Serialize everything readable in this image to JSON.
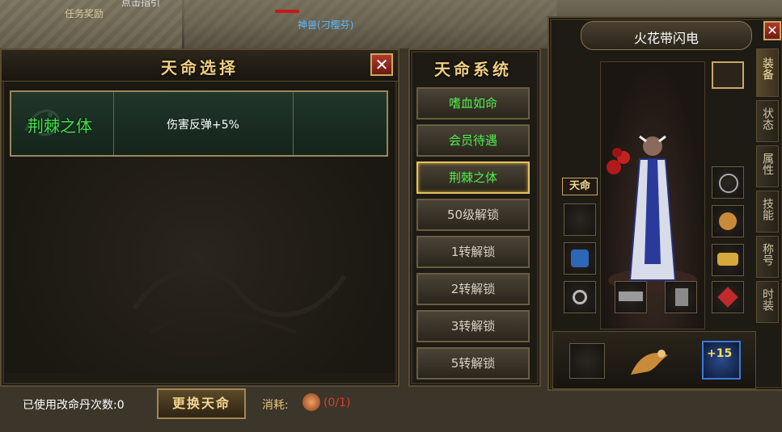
{
  "world": {
    "task_reward_label": "任务奖励",
    "top_left_partial": "点击指引",
    "npc_name": "神兽(刁樱芬)"
  },
  "fate_select": {
    "title": "天命选择",
    "selected_row": {
      "name": "荆棘之体",
      "desc": "伤害反弹+5%"
    },
    "used_count_label": "已使用改命丹次数:0",
    "change_button": "更换天命",
    "cost_label": "消耗:",
    "cost_value": "(0/1)"
  },
  "fate_system": {
    "title": "天命系统",
    "items": [
      {
        "label": "嗜血如命",
        "state": "unlocked"
      },
      {
        "label": "会员待遇",
        "state": "unlocked"
      },
      {
        "label": "荆棘之体",
        "state": "selected"
      },
      {
        "label": "50级解锁",
        "state": "locked"
      },
      {
        "label": "1转解锁",
        "state": "locked"
      },
      {
        "label": "2转解锁",
        "state": "locked"
      },
      {
        "label": "3转解锁",
        "state": "locked"
      },
      {
        "label": "5转解锁",
        "state": "locked"
      }
    ]
  },
  "character": {
    "name": "火花带闪电",
    "fate_tag": "天命",
    "plus_badge": "+15",
    "tabs": [
      {
        "label": "装备"
      },
      {
        "label": "状态"
      },
      {
        "label": "属性"
      },
      {
        "label": "技能"
      },
      {
        "label": "称号"
      },
      {
        "label": "时装"
      }
    ]
  },
  "colors": {
    "accent_gold": "#e9c57a",
    "green_text": "#3fe24a",
    "red_text": "#e43a2a"
  }
}
